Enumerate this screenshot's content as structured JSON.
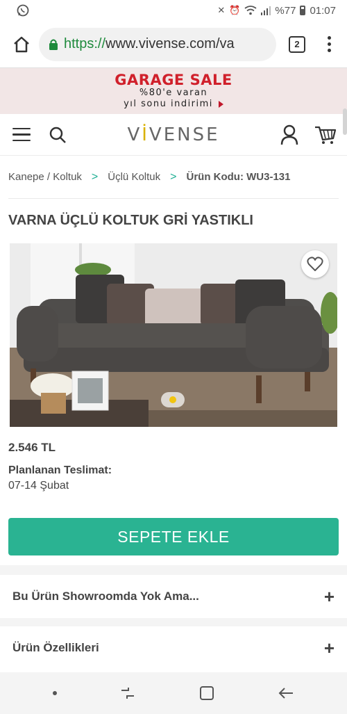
{
  "status_bar": {
    "battery": "%77",
    "time": "01:07"
  },
  "browser": {
    "url_scheme": "https://",
    "url_rest": "www.vivense.com/va",
    "tab_count": "2"
  },
  "promo": {
    "title": "GARAGE SALE",
    "line1": "%80'e varan",
    "line2": "yıl sonu indirimi"
  },
  "header": {
    "logo_pre": "V",
    "logo_accent": "İ",
    "logo_post": "VENSE"
  },
  "breadcrumb": {
    "items": [
      "Kanepe / Koltuk",
      "Üçlü Koltuk"
    ],
    "separator": ">",
    "current": "Ürün Kodu: WU3-131"
  },
  "product": {
    "title": "VARNA ÜÇLÜ KOLTUK GRİ YASTIKLI",
    "price": "2.546 TL",
    "delivery_label": "Planlanan Teslimat:",
    "delivery_value": "07-14 Şubat",
    "add_to_cart_label": "SEPETE EKLE"
  },
  "accordion": [
    {
      "label": "Bu Ürün Showroomda Yok Ama..."
    },
    {
      "label": "Ürün Özellikleri"
    }
  ],
  "colors": {
    "accent": "#2ab392",
    "promo_red": "#d0202b",
    "logo_accent": "#d9b100"
  }
}
